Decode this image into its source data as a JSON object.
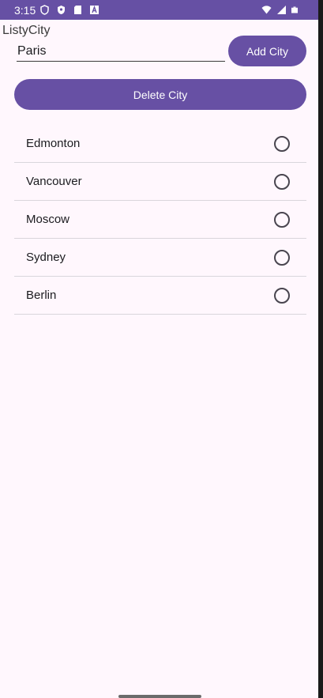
{
  "status_bar": {
    "time": "3:15",
    "left_icons": [
      "shield-icon",
      "vpn-icon",
      "sd-card-icon",
      "a-icon"
    ],
    "right_icons": [
      "wifi-icon",
      "signal-icon",
      "battery-icon"
    ],
    "color": "#6650a4"
  },
  "app": {
    "title": "ListyCity"
  },
  "form": {
    "city_input_value": "Paris",
    "add_button_label": "Add City",
    "delete_button_label": "Delete City"
  },
  "cities": [
    {
      "name": "Edmonton",
      "selected": false
    },
    {
      "name": "Vancouver",
      "selected": false
    },
    {
      "name": "Moscow",
      "selected": false
    },
    {
      "name": "Sydney",
      "selected": false
    },
    {
      "name": "Berlin",
      "selected": false
    }
  ],
  "colors": {
    "accent": "#6750a4",
    "background": "#fff7fd",
    "divider": "#d9d6dc"
  }
}
